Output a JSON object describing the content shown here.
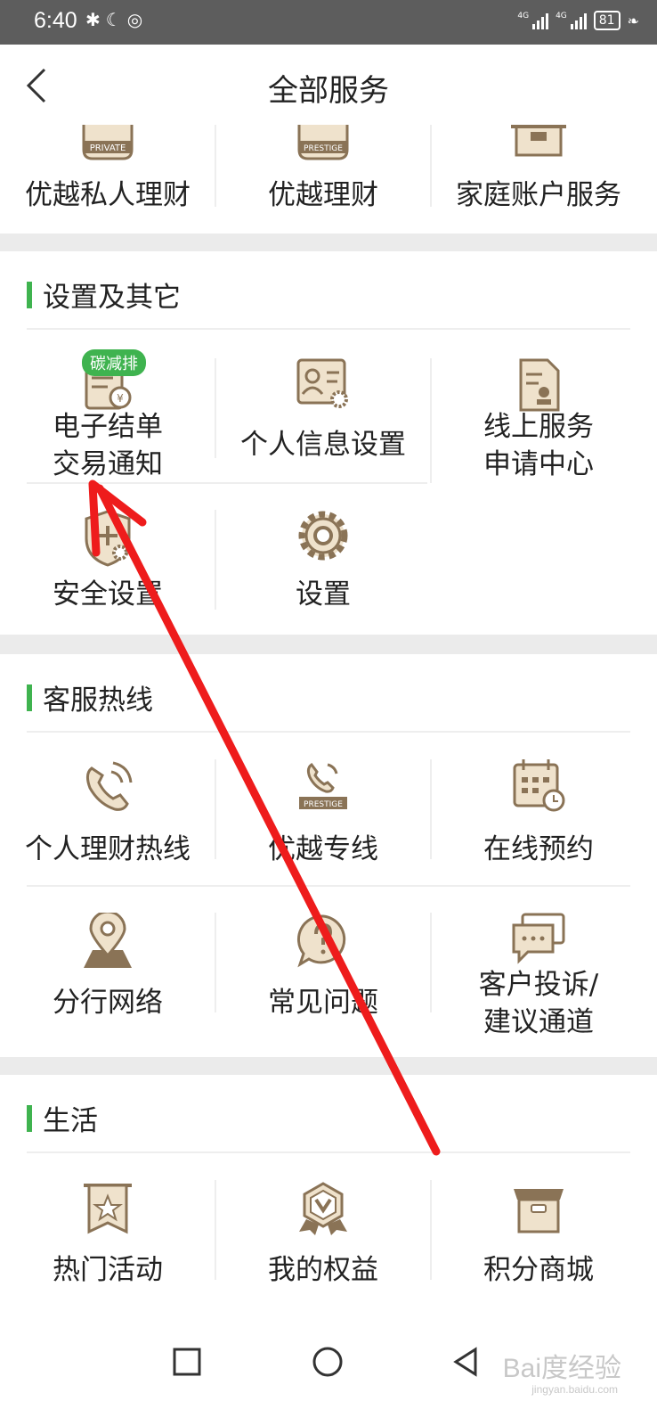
{
  "status_bar": {
    "time": "6:40",
    "battery": "81",
    "network_1": "4G",
    "network_2": "4G"
  },
  "header": {
    "title": "全部服务"
  },
  "top_section": {
    "items": [
      {
        "label": "优越私人理财",
        "icon": "private-wealth-icon",
        "icon_text": "PRIVATE"
      },
      {
        "label": "优越理财",
        "icon": "prestige-wealth-icon",
        "icon_text": "PRESTIGE"
      },
      {
        "label": "家庭账户服务",
        "icon": "family-account-icon"
      }
    ]
  },
  "settings_section": {
    "title": "设置及其它",
    "items": [
      {
        "label_line1": "电子结单",
        "label_line2": "交易通知",
        "icon": "e-statement-icon",
        "badge": "碳减排"
      },
      {
        "label": "个人信息设置",
        "icon": "profile-settings-icon"
      },
      {
        "label_line1": "线上服务",
        "label_line2": "申请中心",
        "icon": "online-service-icon"
      },
      {
        "label": "安全设置",
        "icon": "security-shield-icon"
      },
      {
        "label": "设置",
        "icon": "gear-icon"
      }
    ]
  },
  "hotline_section": {
    "title": "客服热线",
    "items": [
      {
        "label": "个人理财热线",
        "icon": "phone-icon"
      },
      {
        "label": "优越专线",
        "icon": "prestige-phone-icon",
        "icon_text": "PRESTIGE"
      },
      {
        "label": "在线预约",
        "icon": "calendar-icon"
      },
      {
        "label": "分行网络",
        "icon": "map-pin-icon"
      },
      {
        "label": "常见问题",
        "icon": "faq-icon"
      },
      {
        "label_line1": "客户投诉/",
        "label_line2": "建议通道",
        "icon": "chat-icon"
      }
    ]
  },
  "life_section": {
    "title": "生活",
    "items": [
      {
        "label": "热门活动",
        "icon": "star-banner-icon"
      },
      {
        "label": "我的权益",
        "icon": "badge-icon"
      },
      {
        "label": "积分商城",
        "icon": "shop-box-icon"
      }
    ]
  },
  "watermark": {
    "text": "Bai度经验",
    "sub": "jingyan.baidu.com"
  },
  "colors": {
    "accent": "#3fb34f",
    "icon": "#8a7356",
    "icon_fill": "#efe2cc",
    "arrow": "#ee1c1c"
  }
}
